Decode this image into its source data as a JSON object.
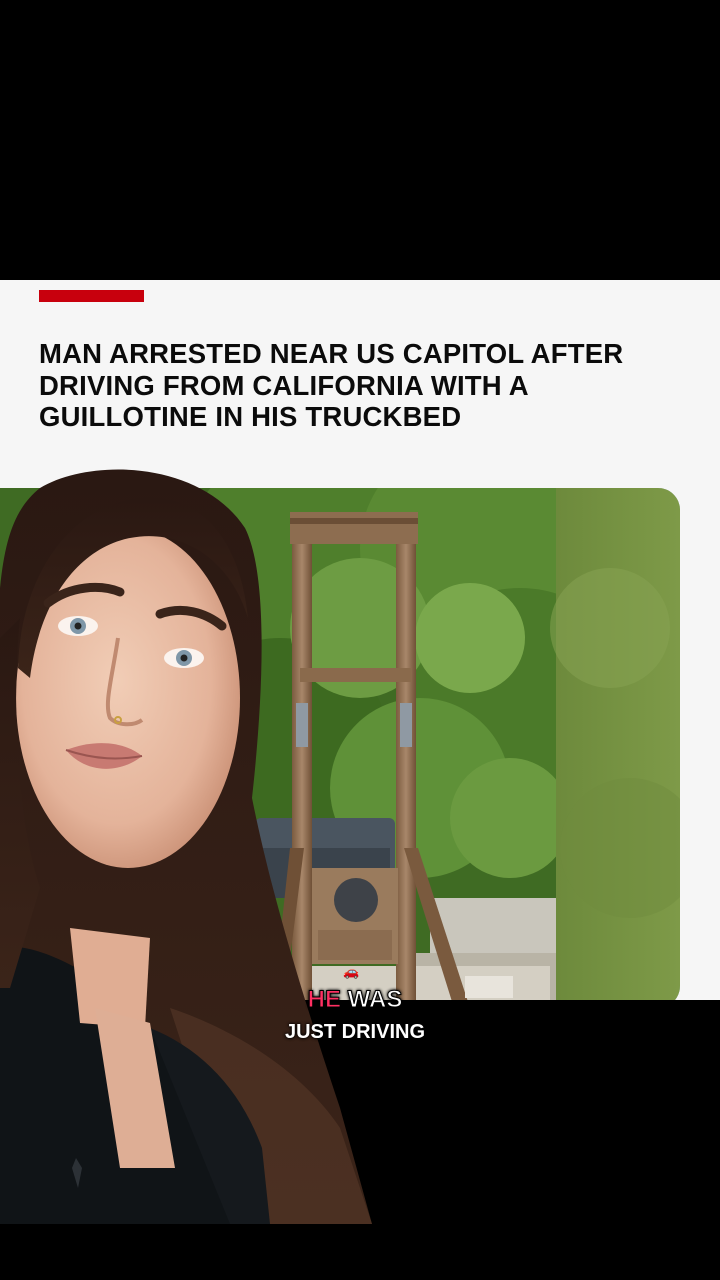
{
  "article": {
    "accent_color": "#c8000d",
    "headline": "MAN ARRESTED NEAR US CAPITOL AFTER DRIVING FROM CALIFORNIA WITH A GUILLOTINE IN HIS TRUCKBED"
  },
  "photo": {
    "icon": "guillotine-photo"
  },
  "caption": {
    "icon": "car-icon",
    "word_highlight": "HE",
    "word_rest": "WAS",
    "line2": "JUST DRIVING",
    "highlight_color": "#ff2f62"
  }
}
